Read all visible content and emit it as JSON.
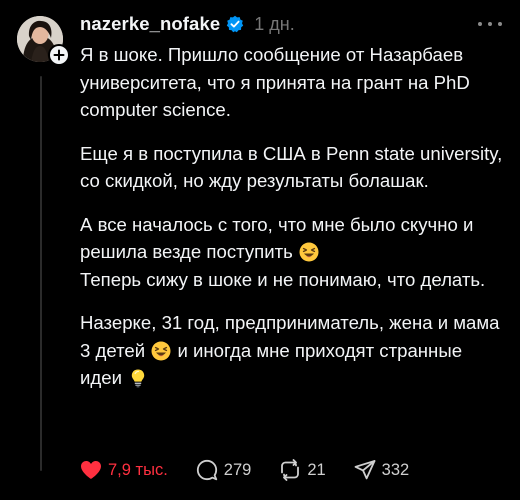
{
  "post": {
    "username": "nazerke_nofake",
    "time": "1 дн.",
    "paragraphs": [
      {
        "text": "Я в шоке. Пришло сообщение от Назарбаев университета, что я принята на грант на PhD computer science."
      },
      {
        "text": "Еще я в поступила в США в Penn state university, со скидкой, но жду результаты болашак."
      },
      {
        "text_before_emoji": "А все началось с того, что мне было скучно и решила везде поступить",
        "emoji": "laughing-squint-emoji"
      },
      {
        "text": "Теперь сижу в шоке и не понимаю, что делать."
      },
      {
        "text_before_emoji": "Назерке, 31 год, предприниматель, жена и мама 3 детей",
        "emoji": "laughing-squint-emoji",
        "text_after_emoji": "и иногда мне приходят странные идеи",
        "emoji_end": "light-bulb-emoji"
      }
    ]
  },
  "actions": {
    "likes": "7,9 тыс.",
    "comments": "279",
    "reposts": "21",
    "shares": "332"
  },
  "colors": {
    "background": "#000000",
    "text": "#f3f5f7",
    "muted": "#777777",
    "like": "#ff3040",
    "verified": "#0095f6"
  }
}
